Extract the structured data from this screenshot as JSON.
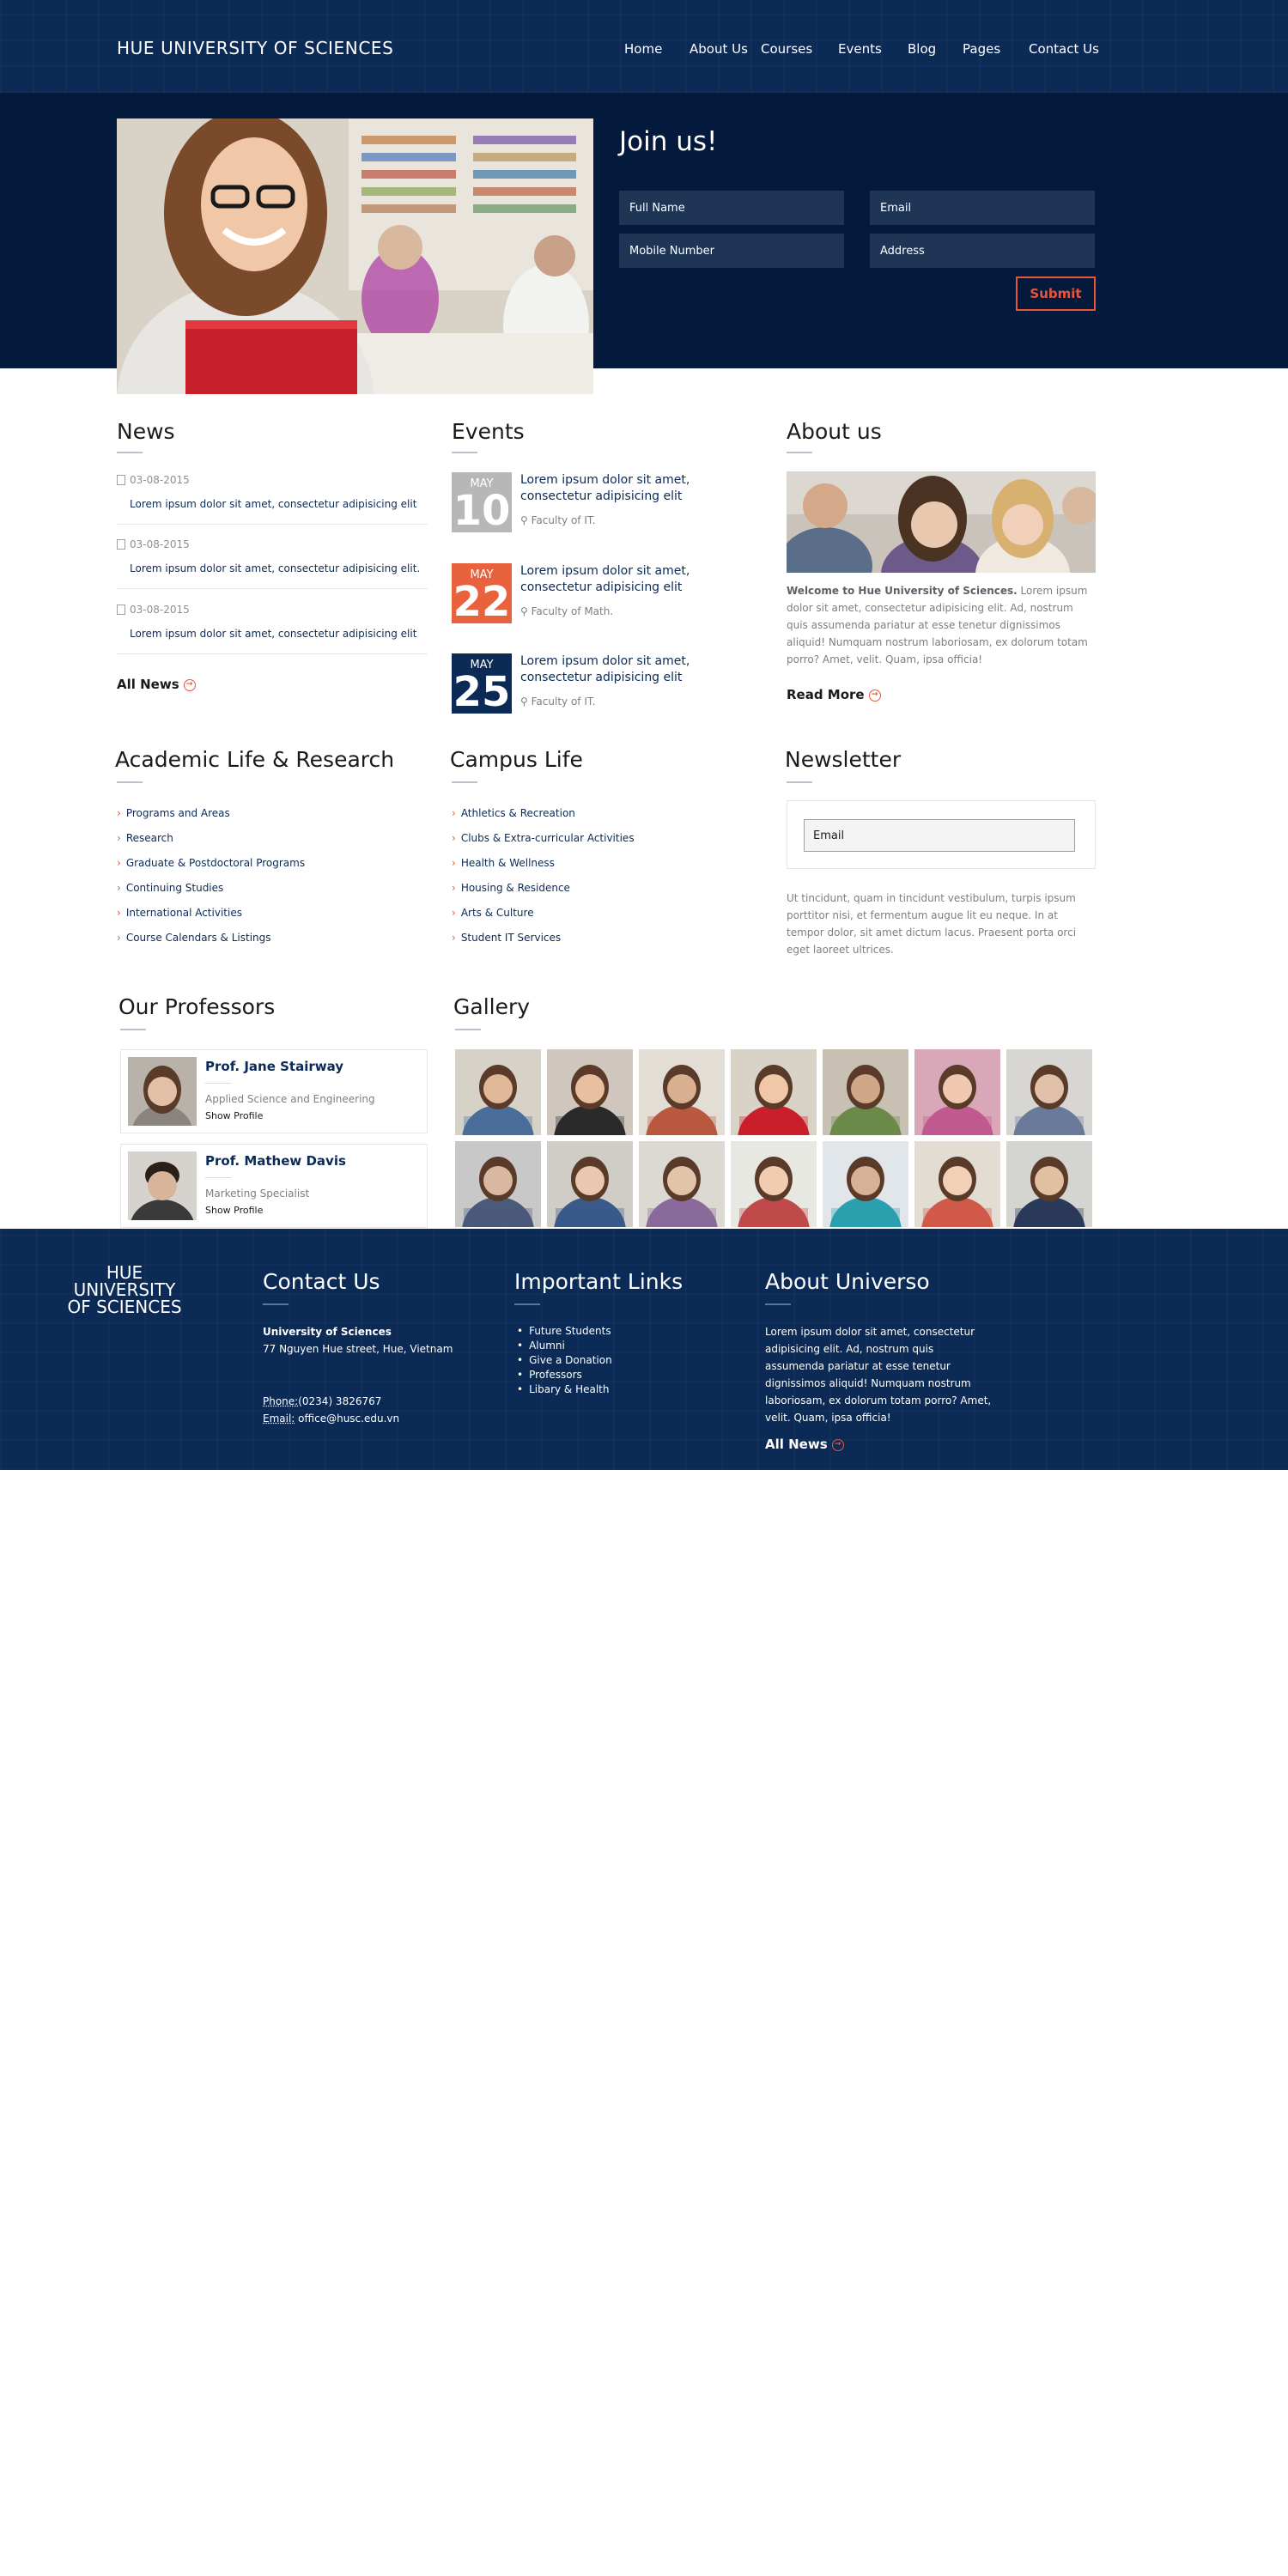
{
  "header": {
    "site_title": "HUE UNIVERSITY OF SCIENCES",
    "nav": [
      "Home",
      "About Us",
      "Courses",
      "Events",
      "Blog",
      "Pages",
      "Contact Us"
    ]
  },
  "hero": {
    "join_title": "Join us!",
    "full_name_placeholder": "Full Name",
    "email_placeholder": "Email",
    "mobile_placeholder": "Mobile Number",
    "address_placeholder": "Address",
    "submit_label": "Submit"
  },
  "news": {
    "heading": "News",
    "items": [
      {
        "date": "03-08-2015",
        "title": "Lorem ipsum dolor sit amet, consectetur adipisicing elit"
      },
      {
        "date": "03-08-2015",
        "title": "Lorem ipsum dolor sit amet, consectetur adipisicing elit."
      },
      {
        "date": "03-08-2015",
        "title": "Lorem ipsum dolor sit amet, consectetur adipisicing elit"
      }
    ],
    "all_label": "All News"
  },
  "events": {
    "heading": "Events",
    "items": [
      {
        "month": "MAY",
        "day": "10",
        "color": "#b7b7b7",
        "title": "Lorem ipsum dolor sit amet, consectetur adipisicing elit",
        "location": "Faculty of IT."
      },
      {
        "month": "MAY",
        "day": "22",
        "color": "#e8623e",
        "title": "Lorem ipsum dolor sit amet, consectetur adipisicing elit",
        "location": "Faculty of Math."
      },
      {
        "month": "MAY",
        "day": "25",
        "color": "#0b2a55",
        "title": "Lorem ipsum dolor sit amet, consectetur adipisicing elit",
        "location": "Faculty of IT."
      }
    ]
  },
  "about": {
    "heading": "About us",
    "lead": "Welcome to Hue University of Sciences.",
    "body": "Lorem ipsum dolor sit amet, consectetur adipisicing elit. Ad, nostrum quis assumenda pariatur at esse tenetur dignissimos aliquid! Numquam nostrum laboriosam, ex dolorum totam porro? Amet, velit. Quam, ipsa officia!",
    "read_more": "Read More"
  },
  "academic": {
    "heading": "Academic Life & Research",
    "items": [
      "Programs and Areas",
      "Research",
      "Graduate & Postdoctoral Programs",
      "Continuing Studies",
      "International Activities",
      "Course Calendars & Listings"
    ]
  },
  "campus": {
    "heading": "Campus Life",
    "items": [
      "Athletics & Recreation",
      "Clubs & Extra-curricular Activities",
      "Health & Wellness",
      "Housing & Residence",
      "Arts & Culture",
      "Student IT Services"
    ]
  },
  "newsletter": {
    "heading": "Newsletter",
    "email_placeholder": "Email",
    "text": "Ut tincidunt, quam in tincidunt vestibulum, turpis ipsum porttitor nisi, et fermentum augue lit eu neque. In at tempor dolor, sit amet dictum lacus. Praesent porta orci eget laoreet ultrices."
  },
  "professors": {
    "heading": "Our Professors",
    "items": [
      {
        "name": "Prof. Jane Stairway",
        "dept": "Applied Science and Engineering",
        "link": "Show Profile"
      },
      {
        "name": "Prof. Mathew Davis",
        "dept": "Marketing Specialist",
        "link": "Show Profile"
      }
    ]
  },
  "gallery": {
    "heading": "Gallery"
  },
  "footer": {
    "logo": "HUE UNIVERSITY OF SCIENCES",
    "contact_heading": "Contact Us",
    "org": "University of Sciences",
    "address": "77 Nguyen Hue street, Hue, Vietnam",
    "phone_label": "Phone:",
    "phone": "(0234) 3826767",
    "email_label": "Email:",
    "email": "office@husc.edu.vn",
    "links_heading": "Important Links",
    "links": [
      "Future Students",
      "Alumni",
      "Give a Donation",
      "Professors",
      "Libary & Health"
    ],
    "about_heading": "About Universo",
    "about_text": "Lorem ipsum dolor sit amet, consectetur adipisicing elit. Ad, nostrum quis assumenda pariatur at esse tenetur dignissimos aliquid! Numquam nostrum laboriosam, ex dolorum totam porro? Amet, velit. Quam, ipsa officia!",
    "all_news": "All News"
  }
}
